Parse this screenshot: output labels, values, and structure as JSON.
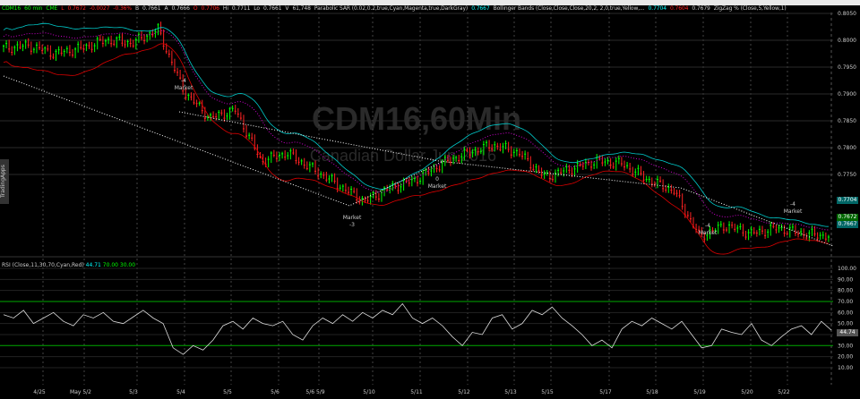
{
  "header": {
    "symbol": "CDM16",
    "interval": "60 min",
    "exchange": "CME",
    "last_label": "L",
    "last": "0.7672",
    "change": "-0.0027",
    "change_pct": "-0.36%",
    "bid_label": "B",
    "bid": "0.7661",
    "ask_label": "A",
    "ask": "0.7666",
    "open_label": "O",
    "open": "0.7706",
    "high_label": "Hi",
    "high": "0.7711",
    "low_label": "Lo",
    "low": "0.7661",
    "vol_label": "V",
    "volume": "61,748",
    "sar": "Parabolic SAR (0.02,0.2,true,Cyan,Magenta,true,DarkGray)",
    "sar_value": "0.7667",
    "bb": "Bollinger Bands (Close,Close,Close,20,2, 2,0,true,Yellow,...",
    "bb_upper": "0.7704",
    "bb_lower": "0.7604",
    "bb_mid": "0.7679",
    "zigzag": "ZigZag % (Close,5,Yellow,1)"
  },
  "watermark": {
    "title": "CDM16,60Min",
    "subtitle": "Canadian Dollar Jun 2016"
  },
  "side_tab": "TradingApps",
  "price_tags": {
    "bb_upper": "0.7704",
    "last": "0.7672",
    "sar": "0.7667"
  },
  "rsi": {
    "label": "RSI (Close,11,30,70,Cyan,Red)",
    "value": "44.71",
    "ob": "70.00",
    "os": "30.00",
    "tag": "44.74"
  },
  "markers": [
    {
      "label": "Market",
      "qty": "-4"
    },
    {
      "label": "Market",
      "qty": "-3"
    },
    {
      "label": "Market",
      "qty": "0"
    },
    {
      "label": "Market",
      "qty": "-4"
    },
    {
      "label": "Market",
      "qty": "-4"
    }
  ],
  "chart_data": [
    {
      "type": "candlestick",
      "title": "CDM16,60Min",
      "ylim": [
        0.767,
        0.806
      ],
      "y_ticks": [
        "0.8050",
        "0.8000",
        "0.7950",
        "0.7900",
        "0.7850",
        "0.7800",
        "0.7750"
      ],
      "x_ticks": [
        "4/25",
        "May 5/2",
        "5/3",
        "5/4",
        "5/5",
        "5/6",
        "5/6 5/9",
        "5/10",
        "5/11",
        "5/12",
        "5/13",
        "5/15",
        "5/17",
        "5/18",
        "5/19",
        "5/20",
        "5/22"
      ],
      "close_path": [
        0.7985,
        0.799,
        0.7975,
        0.7985,
        0.8,
        0.7995,
        0.802,
        0.7905,
        0.7855,
        0.787,
        0.7775,
        0.779,
        0.776,
        0.773,
        0.77,
        0.7725,
        0.774,
        0.777,
        0.779,
        0.7805,
        0.779,
        0.7745,
        0.776,
        0.7775,
        0.777,
        0.774,
        0.772,
        0.7635,
        0.7655,
        0.764,
        0.765,
        0.764,
        0.7635
      ]
    },
    {
      "type": "line",
      "title": "RSI",
      "ylim": [
        0,
        100
      ],
      "y_ticks": [
        "100.00",
        "90.00",
        "80.00",
        "70.00",
        "60.00",
        "50.00",
        "40.00",
        "30.00",
        "20.00",
        "10.00"
      ],
      "values": [
        58,
        55,
        62,
        50,
        55,
        60,
        52,
        48,
        58,
        55,
        60,
        52,
        50,
        56,
        62,
        55,
        50,
        28,
        22,
        30,
        26,
        35,
        48,
        52,
        45,
        55,
        50,
        48,
        52,
        40,
        35,
        48,
        55,
        50,
        58,
        52,
        60,
        55,
        62,
        58,
        68,
        55,
        50,
        55,
        48,
        38,
        30,
        42,
        40,
        55,
        58,
        45,
        50,
        62,
        58,
        65,
        55,
        48,
        40,
        30,
        35,
        28,
        45,
        52,
        48,
        55,
        50,
        45,
        52,
        40,
        28,
        30,
        45,
        42,
        40,
        50,
        35,
        30,
        38,
        45,
        48,
        40,
        52,
        44
      ]
    }
  ]
}
